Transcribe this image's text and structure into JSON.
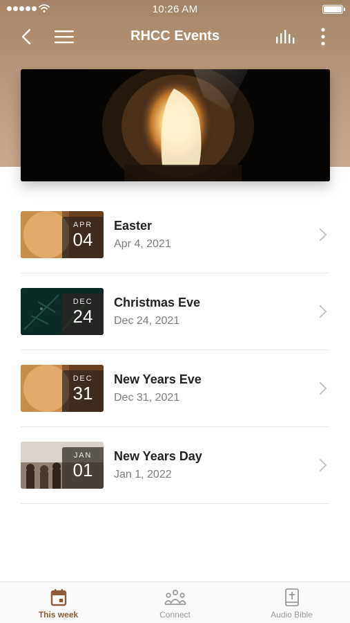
{
  "status_bar": {
    "time": "10:26 AM"
  },
  "nav": {
    "title": "RHCC Events"
  },
  "events": [
    {
      "name": "Easter",
      "date": "Apr 4, 2021",
      "month": "APR",
      "day": "04",
      "thumb": "tomb-icon"
    },
    {
      "name": "Christmas Eve",
      "date": "Dec 24, 2021",
      "month": "DEC",
      "day": "24",
      "thumb": "pine-branch-icon"
    },
    {
      "name": "New Years Eve",
      "date": "Dec 31, 2021",
      "month": "DEC",
      "day": "31",
      "thumb": "tomb-icon"
    },
    {
      "name": "New Years Day",
      "date": "Jan 1, 2022",
      "month": "JAN",
      "day": "01",
      "thumb": "crowd-icon"
    }
  ],
  "tabs": [
    {
      "label": "This week",
      "icon": "calendar-icon",
      "active": true
    },
    {
      "label": "Connect",
      "icon": "people-icon",
      "active": false
    },
    {
      "label": "Audio Bible",
      "icon": "bible-icon",
      "active": false
    }
  ],
  "colors": {
    "header": "#b8987a",
    "accent": "#8b5a3c",
    "muted": "#9a9a9a"
  }
}
